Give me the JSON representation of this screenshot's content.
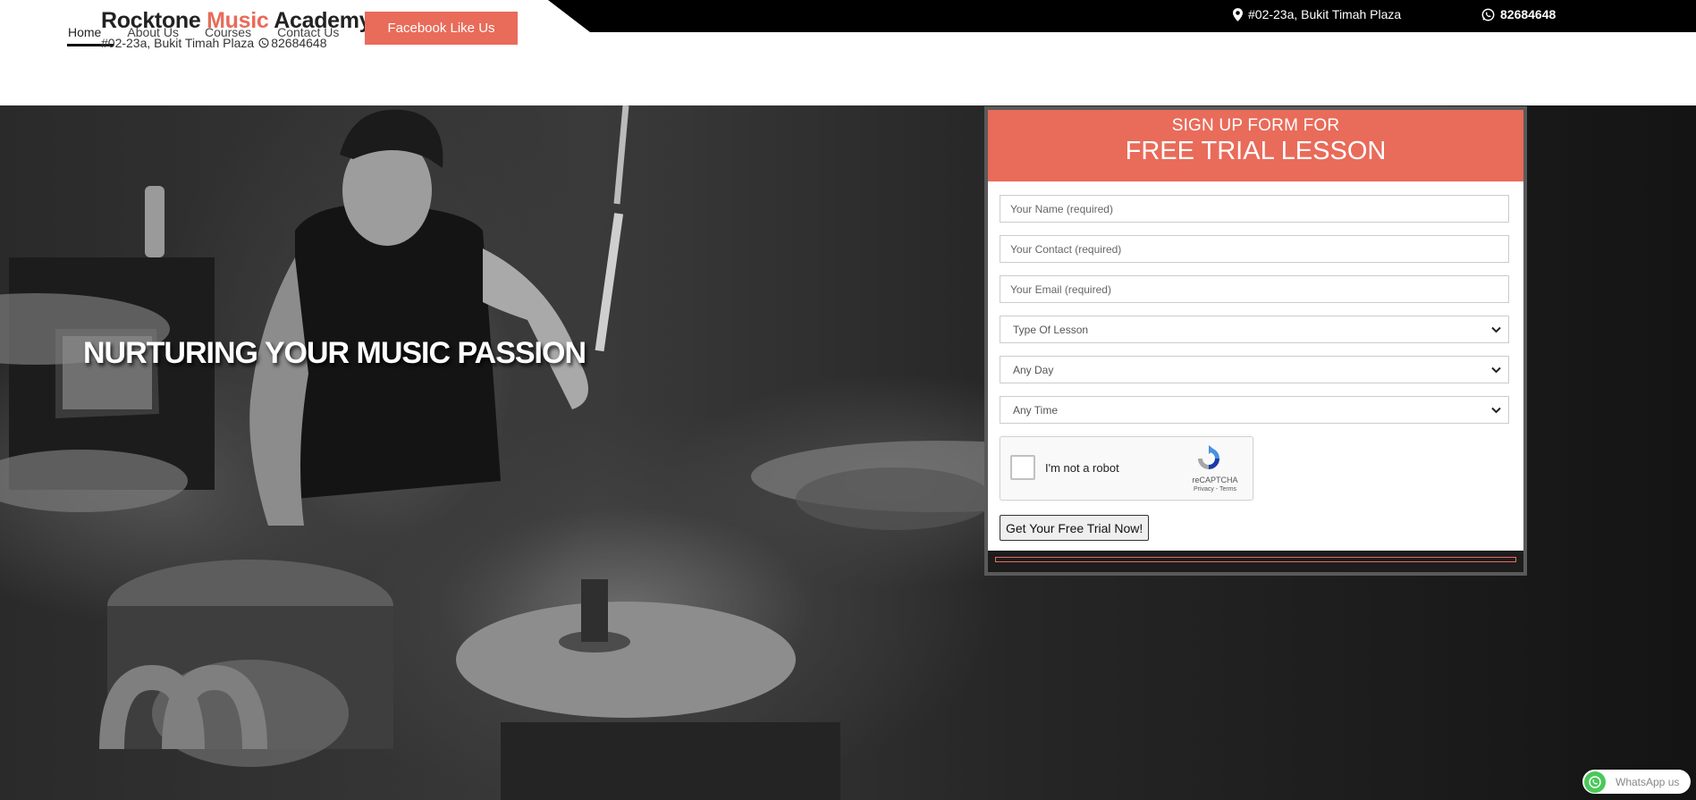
{
  "topbar": {
    "address": "#02-23a, Bukit Timah Plaza",
    "phone": "82684648"
  },
  "brand": {
    "name_part1": "Rocktone ",
    "name_accent": "Music",
    "name_part2": " Academy",
    "sub_address": "#02-23a, Bukit Timah Plaza",
    "sub_phone": "82684648"
  },
  "nav": {
    "items": [
      {
        "label": "Home"
      },
      {
        "label": "About Us"
      },
      {
        "label": "Courses"
      },
      {
        "label": "Contact Us"
      }
    ],
    "active": "Home"
  },
  "header": {
    "facebook_label": "Facebook Like Us"
  },
  "hero": {
    "title": "NURTURING YOUR MUSIC PASSION"
  },
  "form": {
    "subtitle": "SIGN UP FORM FOR",
    "title": "FREE TRIAL LESSON",
    "name_placeholder": "Your Name (required)",
    "contact_placeholder": "Your Contact (required)",
    "email_placeholder": "Your Email (required)",
    "lesson_type": "Type Of Lesson",
    "day": "Any Day",
    "time": "Any Time",
    "captcha_label": "I'm not a robot",
    "captcha_brand": "reCAPTCHA",
    "captcha_links": "Privacy - Terms",
    "submit_label": "Get Your Free Trial Now!"
  },
  "whatsapp": {
    "label": "WhatsApp us"
  },
  "colors": {
    "accent": "#e96b5a",
    "topbar": "#000000",
    "form_border": "#5a5a5a",
    "whatsapp": "#4ac959"
  },
  "icons": [
    "map-pin-icon",
    "whatsapp-icon",
    "chevron-down-icon",
    "recaptcha-icon"
  ]
}
